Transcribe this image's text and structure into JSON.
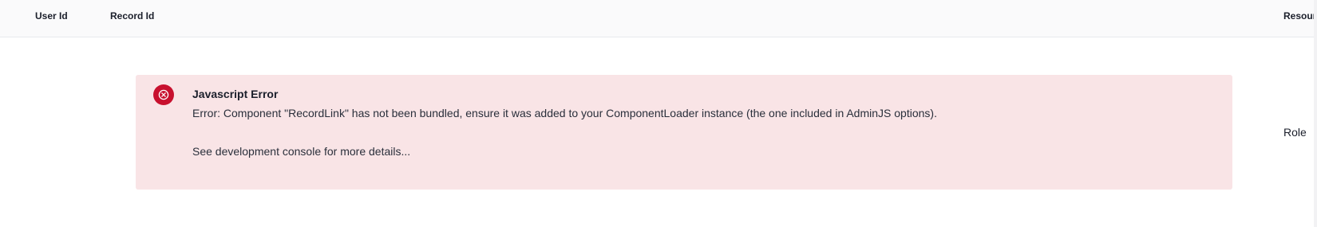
{
  "table": {
    "columns": {
      "user_id": "User Id",
      "record_id": "Record Id",
      "resource": "Resourc"
    },
    "row": {
      "role": "Role"
    }
  },
  "error": {
    "icon": "error-circle-x-icon",
    "title": "Javascript Error",
    "message": "Error: Component \"RecordLink\" has not been bundled, ensure it was added to your ComponentLoader instance (the one included in AdminJS options).",
    "hint": "See development console for more details...",
    "colors": {
      "background": "#f9e4e6",
      "icon": "#c8102e"
    }
  }
}
